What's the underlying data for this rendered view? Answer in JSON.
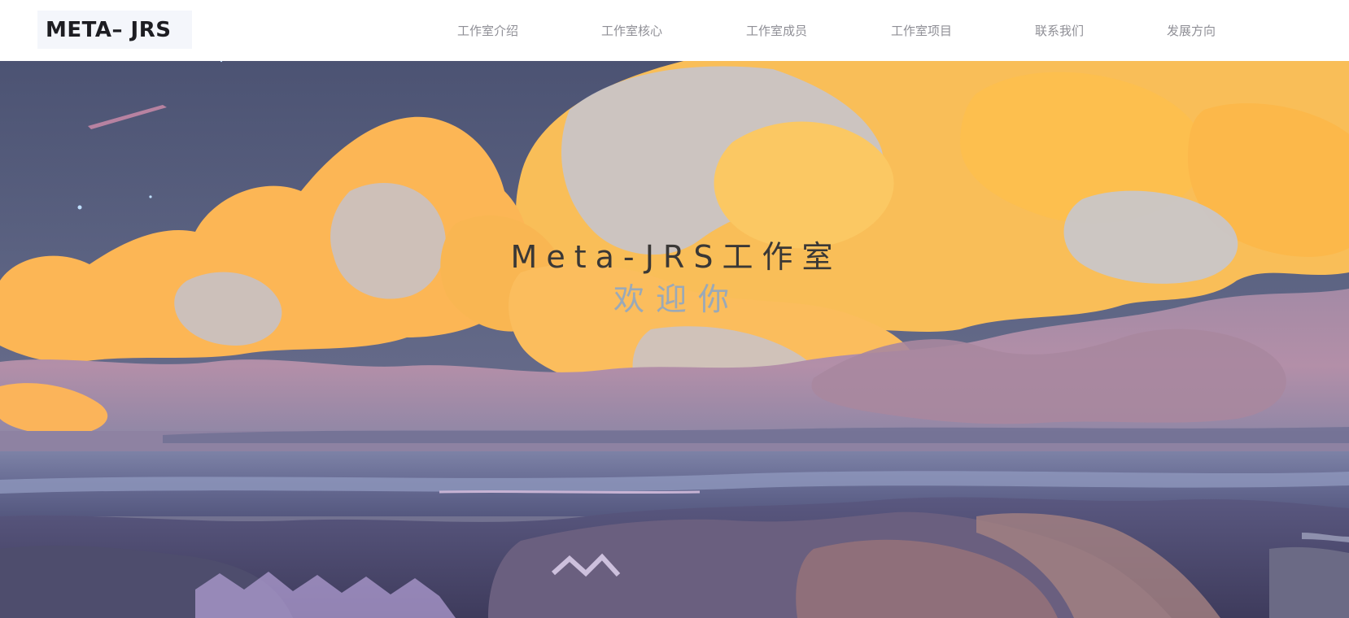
{
  "header": {
    "logo_text": "META– JRS",
    "nav": [
      {
        "label": "工作室介绍"
      },
      {
        "label": "工作室核心"
      },
      {
        "label": "工作室成员"
      },
      {
        "label": "工作室项目"
      },
      {
        "label": "联系我们"
      },
      {
        "label": "发展方向"
      }
    ]
  },
  "hero": {
    "title": "Meta-JRS工作室",
    "subtitle": "欢迎你",
    "background_icon": "painted-sky-clouds-landscape-image"
  },
  "colors": {
    "nav_text": "#8f8f96",
    "title_text": "#3a3836",
    "subtitle_text": "#9aa9b8",
    "cloud_orange": "#fdb94f",
    "sky": "#555c7c"
  }
}
